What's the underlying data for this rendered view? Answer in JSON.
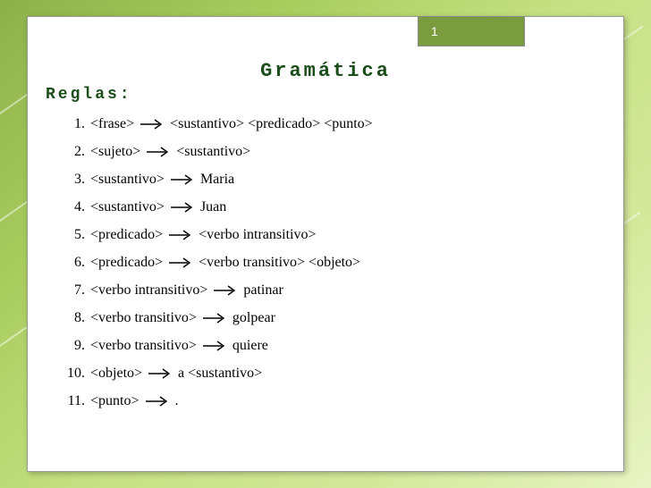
{
  "page_number": "1",
  "title": "Gramática",
  "subtitle": "Reglas:",
  "rules": [
    {
      "num": "1.",
      "lhs": "<frase>",
      "rhs": "<sustantivo> <predicado> <punto>"
    },
    {
      "num": "2.",
      "lhs": "<sujeto>",
      "rhs": "<sustantivo>"
    },
    {
      "num": "3.",
      "lhs": "<sustantivo>",
      "rhs": "Maria"
    },
    {
      "num": "4.",
      "lhs": "<sustantivo>",
      "rhs": "Juan"
    },
    {
      "num": "5.",
      "lhs": "<predicado>",
      "rhs": "<verbo intransitivo>"
    },
    {
      "num": "6.",
      "lhs": "<predicado>",
      "rhs": "<verbo transitivo> <objeto>"
    },
    {
      "num": "7.",
      "lhs": "<verbo intransitivo>",
      "rhs": "patinar"
    },
    {
      "num": "8.",
      "lhs": "<verbo transitivo>",
      "rhs": "golpear"
    },
    {
      "num": "9.",
      "lhs": "<verbo transitivo>",
      "rhs": "quiere"
    },
    {
      "num": "10.",
      "lhs": "<objeto>",
      "rhs": "a <sustantivo>"
    },
    {
      "num": "11.",
      "lhs": "<punto>",
      "rhs": "."
    }
  ]
}
